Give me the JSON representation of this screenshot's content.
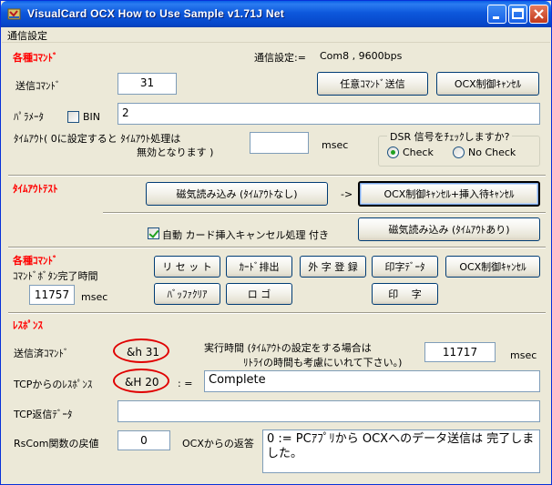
{
  "window": {
    "title": "VisualCard OCX How to Use Sample v1.71J Net"
  },
  "menu": [
    "通信設定"
  ],
  "section1": {
    "heading": "各種ｺﾏﾝﾄﾞ",
    "comm_label": "通信設定:=",
    "comm_value": "Com8 , 9600bps",
    "send_cmd_label": "送信ｺﾏﾝﾄﾞ",
    "send_cmd_value": "31",
    "arbitrary_send_btn": "任意ｺﾏﾝﾄﾞ送信",
    "ocx_cancel_btn": "OCX制御ｷｬﾝｾﾙ",
    "param_label": "ﾊﾟﾗﾒｰﾀ",
    "bin_label": "BIN",
    "bin_checked": false,
    "param_value": "2",
    "timeout_label_1": "ﾀｲﾑｱｳﾄ( 0に設定すると ﾀｲﾑｱｳﾄ処理は",
    "timeout_label_2": "無効となります )",
    "timeout_value": "",
    "msec": "msec",
    "dsr_group_label": "DSR 信号をﾁｪｯｸしますか?",
    "dsr_check": "Check",
    "dsr_nocheck": "No Check",
    "dsr_selected": "Check"
  },
  "section2": {
    "heading": "ﾀｲﾑｱｳﾄﾃｽﾄ",
    "mag_read_no_timeout_btn": "磁気読み込み (ﾀｲﾑｱｳﾄなし)",
    "arrow": "->",
    "ocx_cancel_insert_btn": "OCX制御ｷｬﾝｾﾙ+挿入待ｷｬﾝｾﾙ",
    "auto_cancel_label": "自動 カード挿入キャンセル処理 付き",
    "auto_cancel_checked": true,
    "mag_read_timeout_btn": "磁気読み込み (ﾀｲﾑｱｳﾄあり)"
  },
  "section3": {
    "heading": "各種ｺﾏﾝﾄﾞ",
    "button_time_label": "ｺﾏﾝﾄﾞﾎﾞﾀﾝ完了時間",
    "button_time_value": "11757",
    "msec": "msec",
    "reset_btn": "リ セ ッ ト",
    "card_eject_btn": "ｶｰﾄﾞ排出",
    "ext_char_btn": "外 字 登 録",
    "print_data_btn": "印字ﾃﾞｰﾀ",
    "ocx_cancel_btn": "OCX制御ｷｬﾝｾﾙ",
    "buffer_clear_btn": "ﾊﾞｯﾌｧｸﾘｱ",
    "logo_btn": "ロ ゴ",
    "print_btn": "印 　字"
  },
  "section4": {
    "heading": "ﾚｽﾎﾟﾝｽ",
    "sent_cmd_label": "送信済ｺﾏﾝﾄﾞ",
    "sent_cmd_value": "&h 31",
    "exec_time_label_1": "実行時間 (ﾀｲﾑｱｳﾄの設定をする場合は",
    "exec_time_label_2": "ﾘﾄﾗｲの時間も考慮にいれて下さい。)",
    "exec_time_value": "11717",
    "msec": "msec",
    "tcp_response_label": "TCPからのﾚｽﾎﾟﾝｽ",
    "tcp_response_value": "&H 20",
    "assign": ": =",
    "tcp_response_text": "Complete",
    "tcp_return_data_label": "TCP返信ﾃﾞｰﾀ",
    "tcp_return_data_value": "",
    "rscom_label": "RsCom関数の戻値",
    "rscom_value": "0",
    "ocx_reply_label": "OCXからの返答",
    "ocx_reply_text": "0 := PCｱﾌﾟﾘから OCXへのデータ送信は 完了しました。"
  },
  "colors": {
    "accent_red": "#ff0000",
    "title_blue": "#0a5fe6",
    "dialog_bg": "#ece9d8"
  }
}
